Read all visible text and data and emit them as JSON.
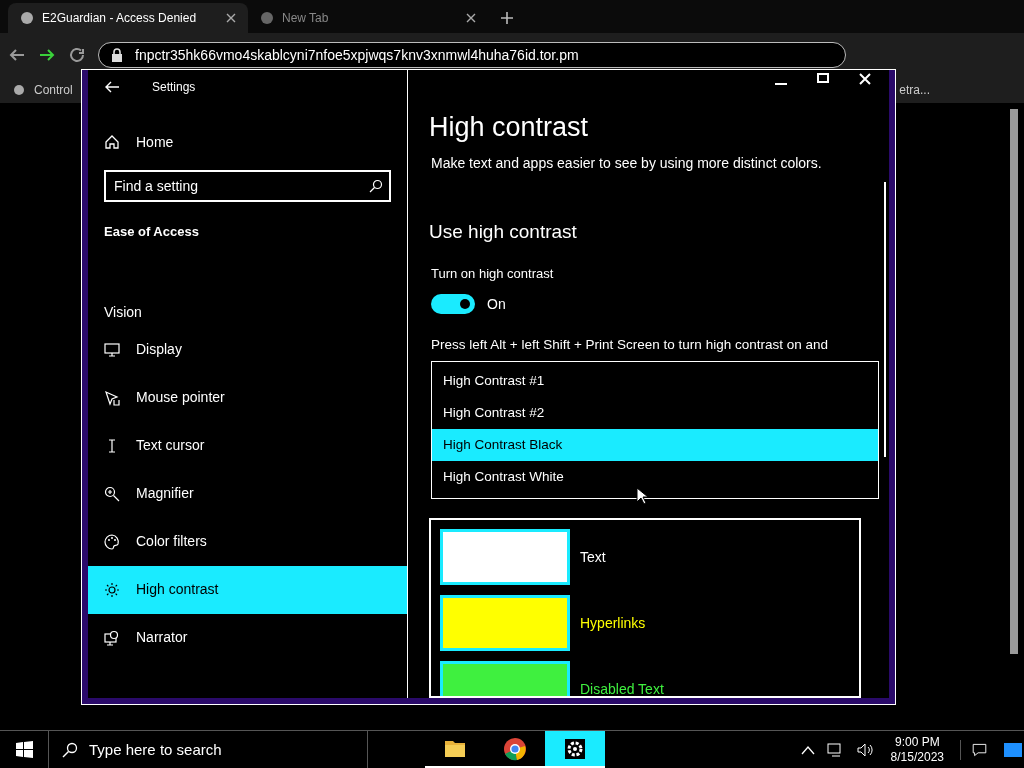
{
  "browser": {
    "tabs": [
      {
        "title": "E2Guardian - Access Denied",
        "selected": true
      },
      {
        "title": "New Tab",
        "selected": false
      }
    ],
    "address": "fnpctr35hk66vmo4skablcyni7nfoe5xpjwqs7knv3xnmwl4huha76id.tor.pm",
    "bookmarks": [
      "Control",
      "etra..."
    ]
  },
  "settings": {
    "title": "Settings",
    "home": "Home",
    "search": {
      "placeholder": "Find a setting"
    },
    "category": "Ease of Access",
    "section": "Vision",
    "items": [
      {
        "label": "Display",
        "kind": "display",
        "selected": false
      },
      {
        "label": "Mouse pointer",
        "kind": "pointer",
        "selected": false
      },
      {
        "label": "Text cursor",
        "kind": "cursor",
        "selected": false
      },
      {
        "label": "Magnifier",
        "kind": "magnifier",
        "selected": false
      },
      {
        "label": "Color filters",
        "kind": "palette",
        "selected": false
      },
      {
        "label": "High contrast",
        "kind": "sun",
        "selected": true
      },
      {
        "label": "Narrator",
        "kind": "narrator",
        "selected": false
      }
    ],
    "page": {
      "heading": "High contrast",
      "description": "Make text and apps easier to see by using more distinct colors.",
      "subheading": "Use high contrast",
      "toggle": {
        "label": "Turn on high contrast",
        "on": true,
        "state": "On"
      },
      "shortcut": "Press left Alt + left Shift + Print Screen to turn high contrast on and",
      "themes": [
        {
          "label": "High Contrast #1",
          "selected": false
        },
        {
          "label": "High Contrast #2",
          "selected": false
        },
        {
          "label": "High Contrast Black",
          "selected": true
        },
        {
          "label": "High Contrast White",
          "selected": false
        }
      ],
      "colors": [
        {
          "label": "Text",
          "color": "#ffffff"
        },
        {
          "label": "Hyperlinks",
          "color": "#ffff00"
        },
        {
          "label": "Disabled Text",
          "color": "#3ff03f"
        }
      ]
    }
  },
  "taskbar": {
    "search": {
      "placeholder": "Type here to search"
    },
    "apps": [
      {
        "kind": "files",
        "selected": false
      },
      {
        "kind": "chrome",
        "selected": false
      },
      {
        "kind": "settings",
        "selected": true
      }
    ],
    "time": "9:00 PM",
    "date": "8/15/2023"
  }
}
